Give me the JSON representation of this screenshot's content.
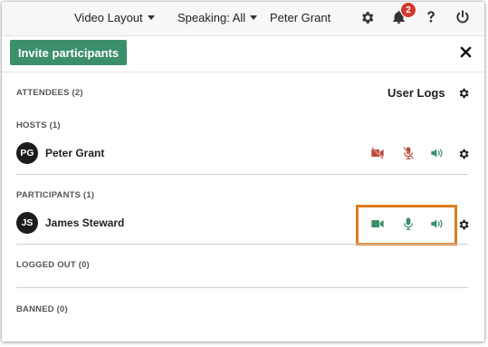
{
  "topbar": {
    "video_layout_label": "Video Layout",
    "speaking_label": "Speaking: All",
    "user_name": "Peter Grant",
    "notification_count": "2"
  },
  "toolbar": {
    "invite_label": "Invite participants"
  },
  "attendees": {
    "label": "ATTENDEES (2)",
    "user_logs_label": "User Logs"
  },
  "hosts": {
    "label": "HOSTS (1)",
    "items": [
      {
        "initials": "PG",
        "name": "Peter Grant",
        "video": "off",
        "mic": "off",
        "audio": "on"
      }
    ]
  },
  "participants": {
    "label": "PARTICIPANTS (1)",
    "items": [
      {
        "initials": "JS",
        "name": "James Steward",
        "video": "on",
        "mic": "on",
        "audio": "on"
      }
    ]
  },
  "logged_out": {
    "label": "LOGGED OUT (0)"
  },
  "banned": {
    "label": "BANNED (0)"
  },
  "colors": {
    "accent_green": "#3c8f6b",
    "muted_red": "#b8473a",
    "badge_red": "#d23a2e",
    "highlight_orange": "#e07b22"
  }
}
